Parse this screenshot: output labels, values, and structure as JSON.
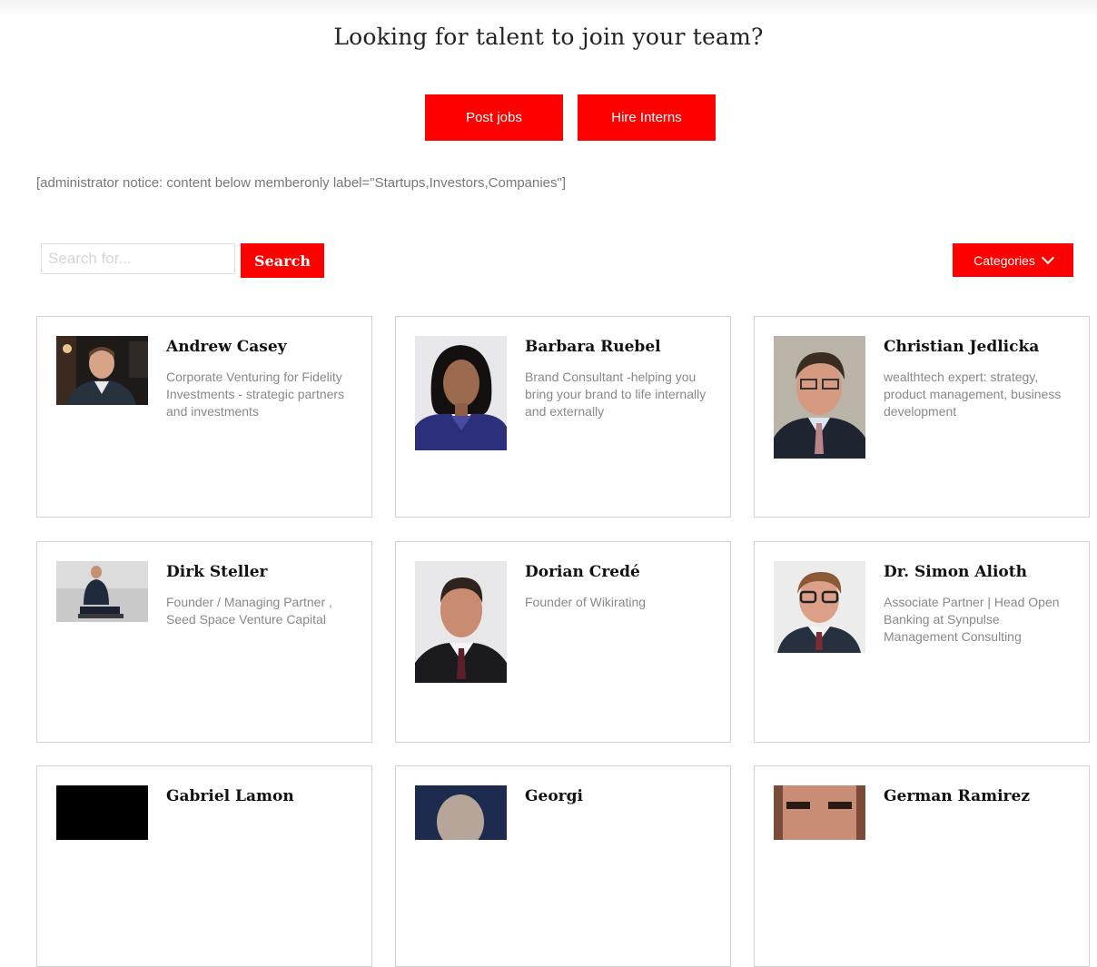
{
  "header": {
    "headline": "Looking for talent to join your team?",
    "post_jobs_label": "Post jobs",
    "hire_interns_label": "Hire Interns"
  },
  "notice": "[administrator notice: content below memberonly label=\"Startups,Investors,Companies\"]",
  "search": {
    "placeholder": "Search for...",
    "button_label": "Search"
  },
  "categories_label": "Categories",
  "colors": {
    "accent": "#fe0000",
    "border": "#d2d2d2",
    "muted_text": "#888888"
  },
  "members": [
    {
      "name": "Andrew Casey",
      "description": "Corporate Venturing for Fidelity Investments - strategic partners and investments",
      "photo": "portrait-dark-background"
    },
    {
      "name": "Barbara Ruebel",
      "description": "Brand Consultant -helping you bring your brand to life internally and externally",
      "photo": "portrait-purple-blazer"
    },
    {
      "name": "Christian Jedlicka",
      "description": "wealthtech expert: strategy, product management, business development",
      "photo": "portrait-glasses-suit"
    },
    {
      "name": "Dirk Steller",
      "description": "Founder / Managing Partner , Seed Space Venture Capital",
      "photo": "portrait-seated-suit"
    },
    {
      "name": "Dorian Credé",
      "description": "Founder of Wikirating",
      "photo": "portrait-suit-tie"
    },
    {
      "name": "Dr. Simon Alioth",
      "description": "Associate Partner | Head Open Banking at Synpulse Management Consulting",
      "photo": "portrait-glasses-smile"
    },
    {
      "name": "Gabriel Lamon",
      "description": "",
      "photo": "portrait-black"
    },
    {
      "name": "Georgi",
      "description": "",
      "photo": "portrait-navy"
    },
    {
      "name": "German Ramirez",
      "description": "",
      "photo": "portrait-closeup"
    }
  ]
}
